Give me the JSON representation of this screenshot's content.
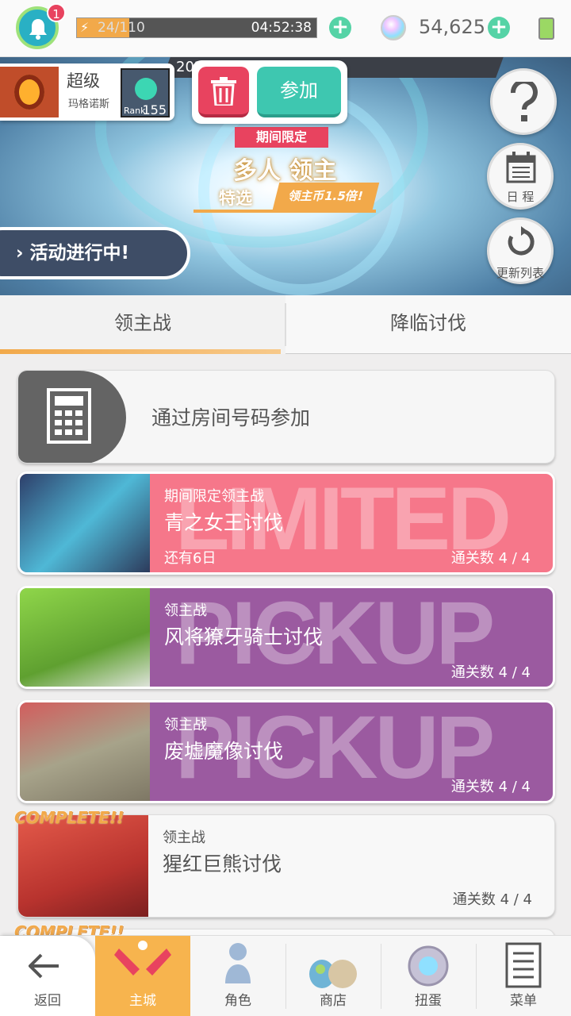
{
  "topbar": {
    "notification_count": "1",
    "stamina_text": "24/110",
    "stamina_fraction": 0.22,
    "stamina_timer": "04:52:38",
    "gem_count": "54,625"
  },
  "banner": {
    "date_text": "2023.06/29 11:59",
    "promo_tag": "期间限定",
    "promo_title": "多人 领主",
    "promo_selected": "特选",
    "promo_coin": "领主币1.5倍!",
    "event_button": "活动进行中!",
    "help_icon": "question-icon",
    "schedule_label": "日 程",
    "refresh_label": "更新列表"
  },
  "room_popup": {
    "host_name": "超级",
    "host_sub": "玛格诺斯",
    "rank_label": "Rank",
    "rank_value": "155",
    "join_label": "参加"
  },
  "tabs": [
    {
      "label": "领主战",
      "active": true
    },
    {
      "label": "降临讨伐",
      "active": false
    }
  ],
  "room_number_entry": {
    "label": "通过房间号码参加"
  },
  "boss_list": [
    {
      "watermark": "LIMITED",
      "category": "期间限定领主战",
      "name": "青之女王讨伐",
      "remaining": "还有6日",
      "clear_count": "通关数 4 / 4",
      "style": "pink",
      "complete": false
    },
    {
      "watermark": "PICKUP",
      "category": "领主战",
      "name": "风将獠牙骑士讨伐",
      "remaining": "",
      "clear_count": "通关数 4 / 4",
      "style": "purple",
      "complete": false
    },
    {
      "watermark": "PICKUP",
      "category": "领主战",
      "name": "废墟魔像讨伐",
      "remaining": "",
      "clear_count": "通关数 4 / 4",
      "style": "purple",
      "complete": false
    },
    {
      "watermark": "",
      "category": "领主战",
      "name": "猩红巨熊讨伐",
      "remaining": "",
      "clear_count": "通关数 4 / 4",
      "style": "done",
      "complete": true,
      "complete_text": "COMPLETE!!"
    }
  ],
  "next_complete_text": "COMPLETE!!",
  "bottom_nav": [
    {
      "label": "返回",
      "icon": "back-arrow-icon"
    },
    {
      "label": "主城",
      "icon": "castle-icon",
      "active": true
    },
    {
      "label": "角色",
      "icon": "character-icon"
    },
    {
      "label": "商店",
      "icon": "shop-icon"
    },
    {
      "label": "扭蛋",
      "icon": "gacha-icon"
    },
    {
      "label": "菜单",
      "icon": "menu-icon"
    }
  ],
  "colors": {
    "accent_orange": "#f2a94a",
    "pink": "#f6778a",
    "purple": "#9b5aa0",
    "teal": "#3ec7b0",
    "red": "#e8435f"
  }
}
